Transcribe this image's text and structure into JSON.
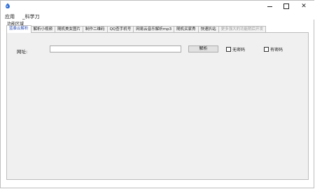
{
  "window": {
    "controls": {
      "close_glyph": "✕"
    }
  },
  "menubar": {
    "items": [
      "应用",
      "_科学刀"
    ]
  },
  "groupbox": {
    "label": "功能区域"
  },
  "tabs": [
    {
      "label": "蓝奏云解析",
      "state": "active"
    },
    {
      "label": "解析小视频",
      "state": "normal"
    },
    {
      "label": "随机美女图片",
      "state": "normal"
    },
    {
      "label": "制作二维码",
      "state": "normal"
    },
    {
      "label": "QQ查手机号",
      "state": "normal"
    },
    {
      "label": "网易云音乐解析mp3",
      "state": "normal"
    },
    {
      "label": "随机买家秀",
      "state": "normal"
    },
    {
      "label": "快速扒站",
      "state": "normal"
    },
    {
      "label": "更多强大的功能稍后开发",
      "state": "disabled"
    }
  ],
  "form": {
    "url_label": "网址:",
    "url_value": "",
    "parse_button": "解析",
    "checkboxes": [
      {
        "label": "无密码",
        "checked": false
      },
      {
        "label": "有密码",
        "checked": false
      }
    ]
  },
  "colors": {
    "active_tab_text": "#2c4fb4",
    "panel_bg": "#f0f0f0",
    "app_icon": "#2f6fd6"
  }
}
